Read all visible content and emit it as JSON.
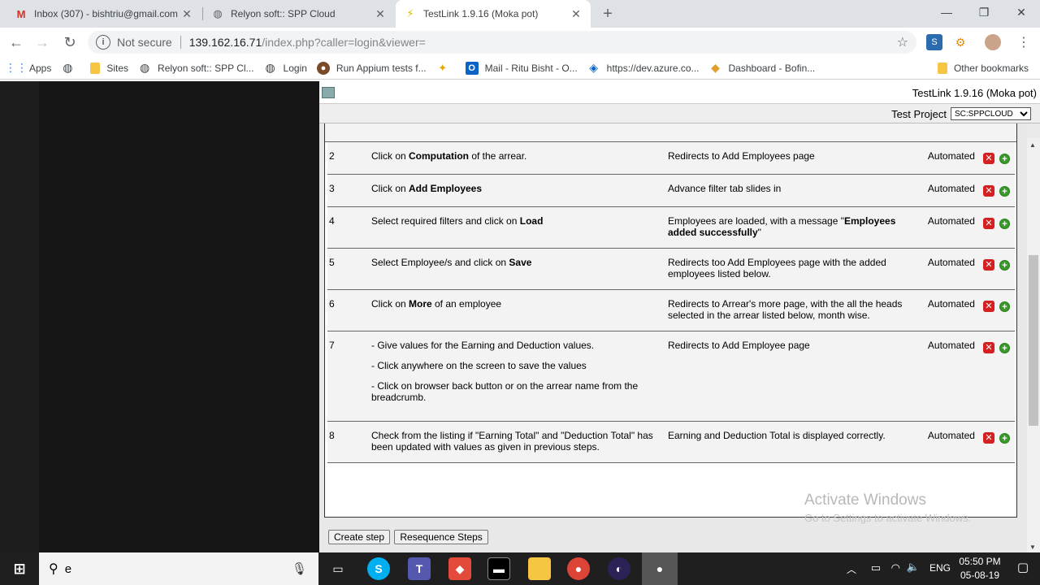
{
  "browser": {
    "tabs": [
      {
        "title": "Inbox (307) - bishtriu@gmail.com",
        "icon": "gmail-icon"
      },
      {
        "title": "Relyon soft:: SPP Cloud",
        "icon": "globe-icon"
      },
      {
        "title": "TestLink 1.9.16 (Moka pot)",
        "icon": "testlink-icon"
      }
    ],
    "new_tab": "+",
    "address": {
      "security": "Not secure",
      "host": "139.162.16.71",
      "path": "/index.php?caller=login&viewer="
    },
    "bookmarks": [
      "Apps",
      "Sites",
      "Relyon soft:: SPP Cl...",
      "Login",
      "Run Appium tests f...",
      "Mail - Ritu Bisht - O...",
      "https://dev.azure.co...",
      "Dashboard - Bofin..."
    ],
    "other_bookmarks": "Other bookmarks"
  },
  "testlink": {
    "version": "TestLink 1.9.16 (Moka pot)",
    "project_label": "Test Project",
    "project_value": "SC:SPPCLOUD"
  },
  "steps": [
    {
      "num": "2",
      "action": [
        [
          "Click on ",
          "Computation",
          " of the arrear."
        ]
      ],
      "expected": [
        [
          "Redirects to Add Employees page"
        ]
      ],
      "type": "Automated"
    },
    {
      "num": "3",
      "action": [
        [
          "Click on ",
          "Add Employees",
          ""
        ]
      ],
      "expected": [
        [
          "Advance filter tab slides in"
        ]
      ],
      "type": "Automated"
    },
    {
      "num": "4",
      "action": [
        [
          "Select required filters and click on ",
          "Load",
          ""
        ]
      ],
      "expected": [
        [
          "Employees are loaded, with a message \"",
          "Employees added successfully",
          "\""
        ]
      ],
      "type": "Automated"
    },
    {
      "num": "5",
      "action": [
        [
          "Select Employee/s and click on ",
          "Save",
          ""
        ]
      ],
      "expected": [
        [
          "Redirects too Add Employees page with the added employees listed below."
        ]
      ],
      "type": "Automated"
    },
    {
      "num": "6",
      "action": [
        [
          "Click on ",
          "More",
          "  of an employee"
        ]
      ],
      "expected": [
        [
          "Redirects to Arrear's more page, with the all the heads selected in the arrear listed below, month wise."
        ]
      ],
      "type": "Automated"
    },
    {
      "num": "7",
      "action": [
        [
          "- Give values for the Earning and Deduction values."
        ],
        [
          "- Click anywhere on the screen to save the values"
        ],
        [
          "- Click on browser back button or on the arrear name from the breadcrumb."
        ]
      ],
      "expected": [
        [
          "Redirects to Add Employee page"
        ]
      ],
      "type": "Automated"
    },
    {
      "num": "8",
      "action": [
        [
          "Check from the listing if \"Earning Total\" and \"Deduction Total\" has been updated with values as given in previous steps."
        ]
      ],
      "expected": [
        [
          "Earning and Deduction Total is displayed correctly."
        ]
      ],
      "type": "Automated"
    }
  ],
  "buttons": {
    "create_step": "Create step",
    "resequence": "Resequence Steps"
  },
  "watermark": {
    "line1": "Activate Windows",
    "line2": "Go to Settings to activate Windows."
  },
  "taskbar": {
    "search_text": "e",
    "language": "ENG",
    "time": "05:50 PM",
    "date": "05-08-19"
  }
}
